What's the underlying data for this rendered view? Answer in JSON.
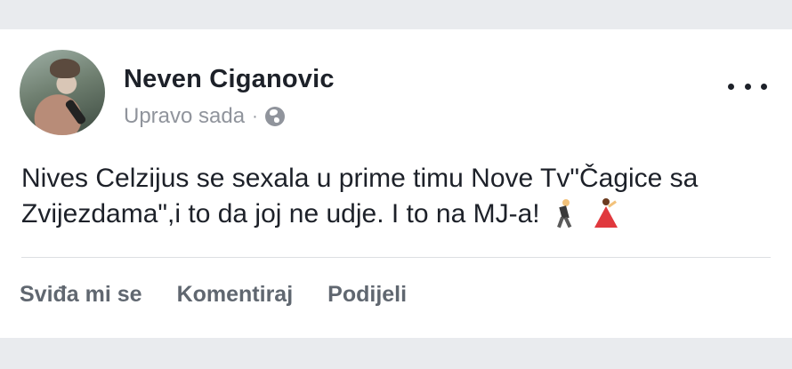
{
  "post": {
    "author": "Neven Ciganovic",
    "timestamp": "Upravo sada",
    "separator": "·",
    "audience_icon": "globe-icon",
    "more_icon": "more-options-icon",
    "text": "Nives Celzijus se sexala u prime timu Nove Tv\"Čagice sa Zvijezdama\",i to da joj ne udje. I to na MJ-a!",
    "emojis": [
      "man-dancing-emoji",
      "woman-dancing-emoji"
    ]
  },
  "actions": {
    "like": "Sviđa mi se",
    "comment": "Komentiraj",
    "share": "Podijeli"
  },
  "colors": {
    "background_band": "#e9ebee",
    "name": "#1d2129",
    "meta": "#90949c",
    "action": "#606770"
  }
}
